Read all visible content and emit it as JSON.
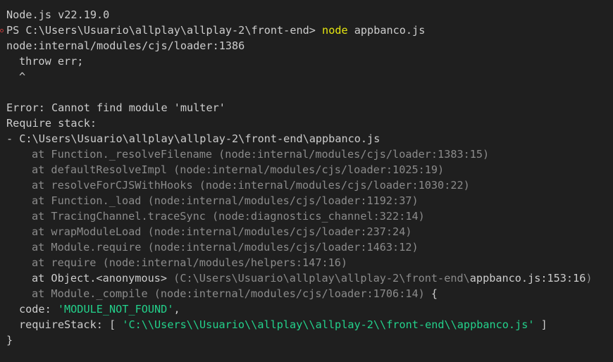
{
  "terminal": {
    "version_line": "Node.js v22.19.0",
    "prompt": {
      "path": "PS C:\\Users\\Usuario\\allplay\\allplay-2\\front-end> ",
      "command": "node",
      "argument": " appbanco.js"
    },
    "loader_line": "node:internal/modules/cjs/loader:1386",
    "throw_line": "throw err;",
    "caret_line": "^",
    "error_line": "Error: Cannot find module 'multer'",
    "require_stack_label": "Require stack:",
    "require_stack_entry": "- C:\\Users\\Usuario\\allplay\\allplay-2\\front-end\\appbanco.js",
    "stack_frames": [
      "at Function._resolveFilename (node:internal/modules/cjs/loader:1383:15)",
      "at defaultResolveImpl (node:internal/modules/cjs/loader:1025:19)",
      "at resolveForCJSWithHooks (node:internal/modules/cjs/loader:1030:22)",
      "at Function._load (node:internal/modules/cjs/loader:1192:37)",
      "at TracingChannel.traceSync (node:diagnostics_channel:322:14)",
      "at wrapModuleLoad (node:internal/modules/cjs/loader:237:24)",
      "at Module.require (node:internal/modules/cjs/loader:1463:12)",
      "at require (node:internal/modules/helpers:147:16)"
    ],
    "anon_frame": {
      "prefix": "at Object.<anonymous> ",
      "dim_middle": "(C:\\Users\\Usuario\\allplay\\allplay-2\\front-end\\",
      "file": "appbanco.js:153:16",
      "suffix": ")"
    },
    "compile_frame": {
      "text": "at Module._compile (node:internal/modules/cjs/loader:1706:14)",
      "brace": " {"
    },
    "code_key": "code: ",
    "code_value": "'MODULE_NOT_FOUND'",
    "code_comma": ",",
    "require_stack_key": "requireStack: [ ",
    "require_stack_value": "'C:\\\\Users\\\\Usuario\\\\allplay\\\\allplay-2\\\\front-end\\\\appbanco.js'",
    "require_stack_close": " ]",
    "closing_brace": "}"
  },
  "colors": {
    "background": "#1f1f1f",
    "foreground": "#cccccc",
    "dim": "#8b8b8b",
    "command": "#e5e510",
    "string": "#23d18b",
    "marker": "#c23b3b"
  }
}
